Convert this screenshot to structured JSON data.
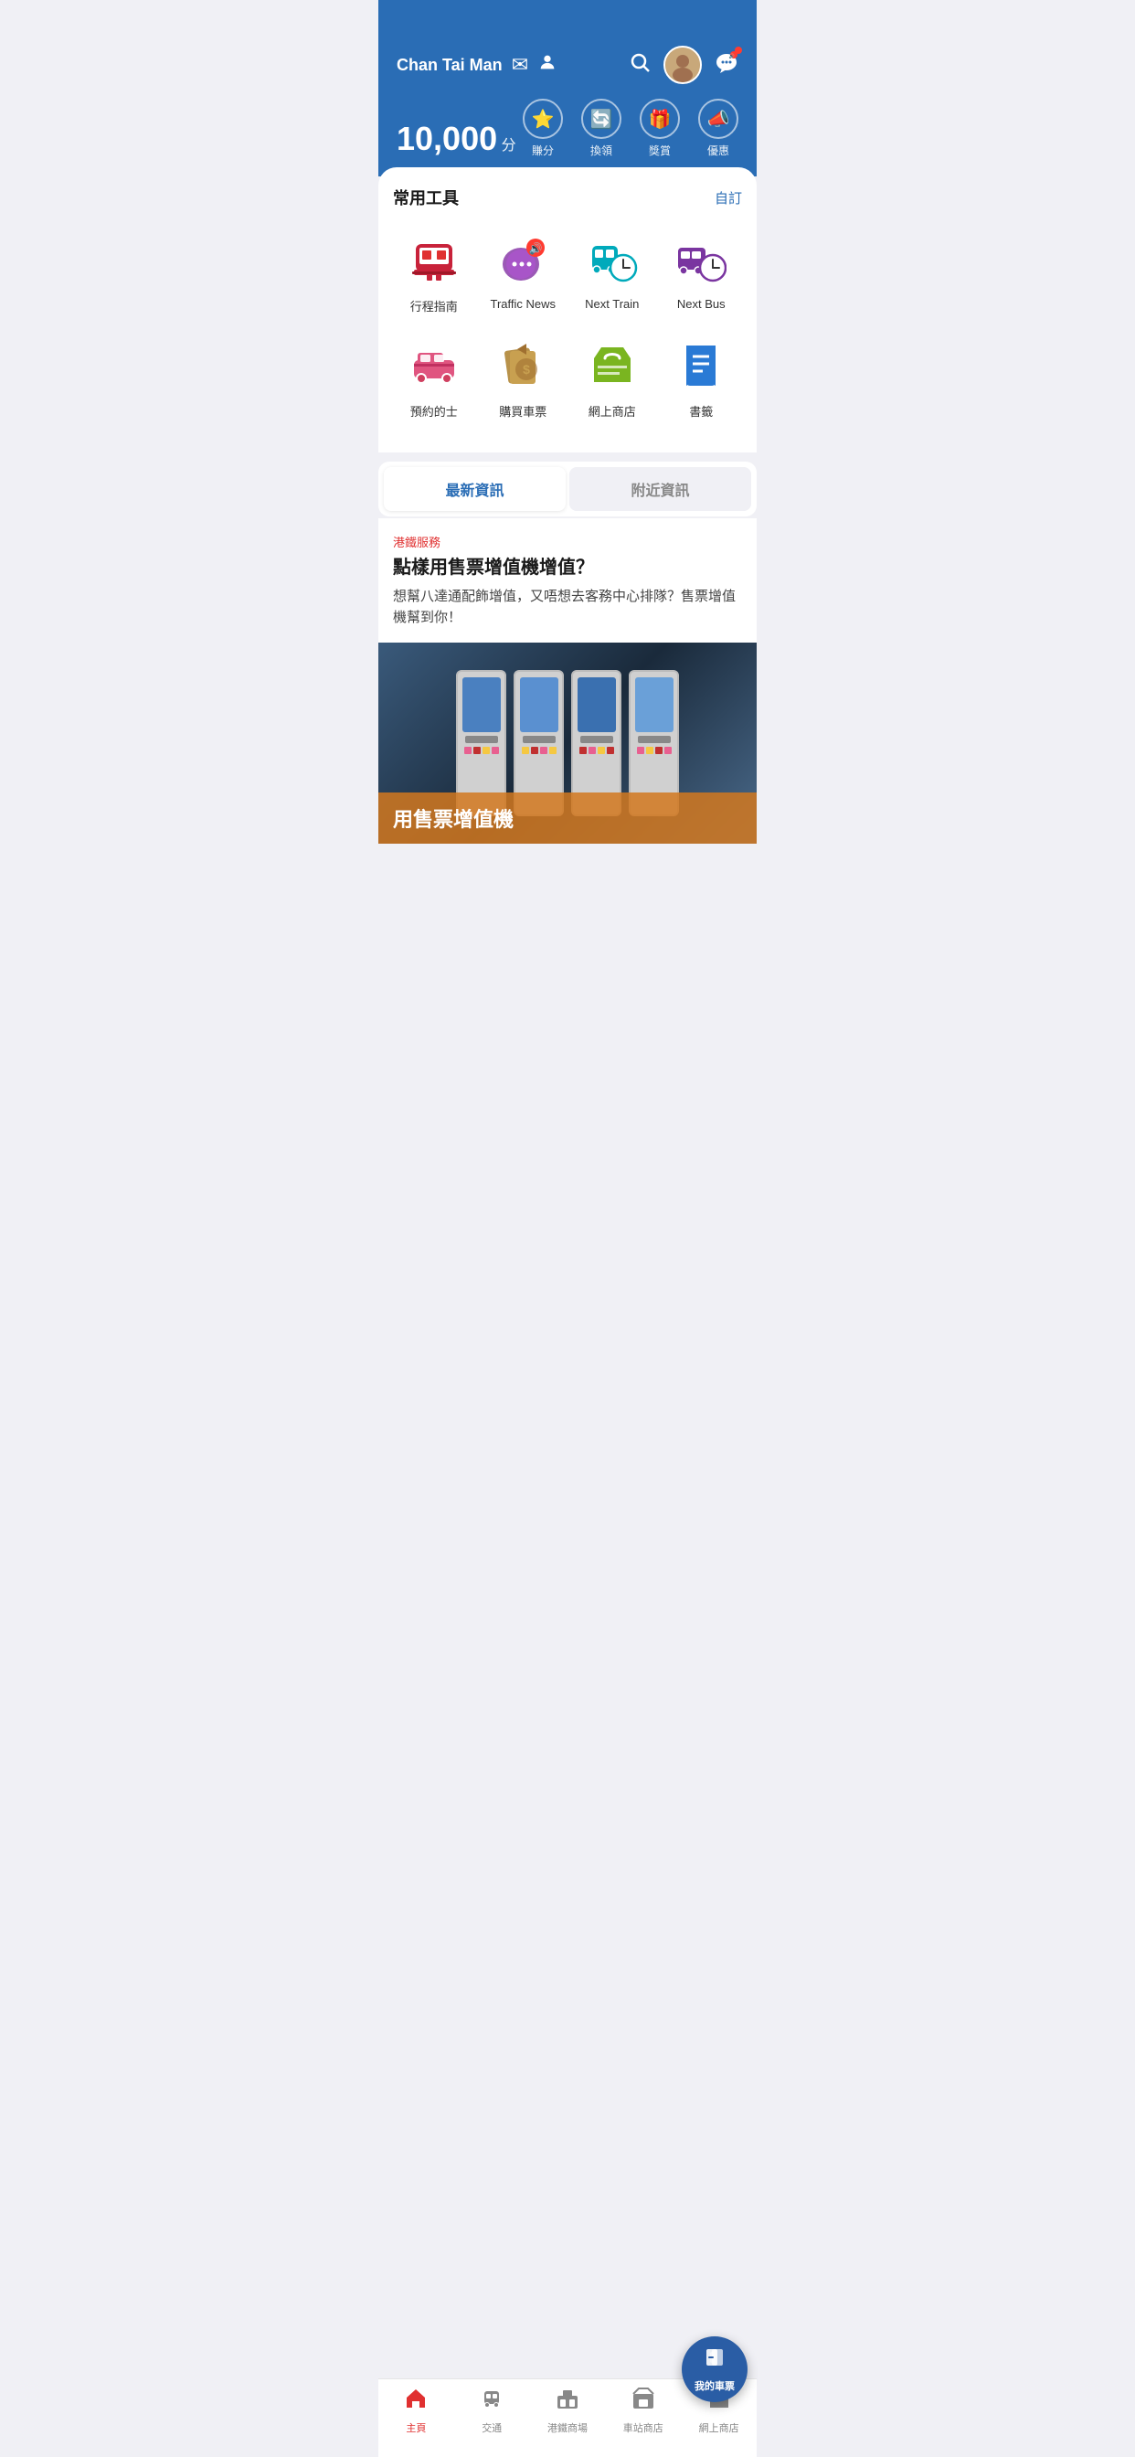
{
  "header": {
    "username": "Chan Tai Man",
    "points": "10,000",
    "points_unit": "分",
    "actions": [
      {
        "id": "earn",
        "label": "賺分",
        "icon": "⭐"
      },
      {
        "id": "redeem",
        "label": "換領",
        "icon": "🔄"
      },
      {
        "id": "rewards",
        "label": "獎賞",
        "icon": "🎁"
      },
      {
        "id": "offers",
        "label": "優惠",
        "icon": "📣"
      }
    ]
  },
  "tools": {
    "section_title": "常用工具",
    "customize_label": "自訂",
    "items": [
      {
        "id": "journey",
        "label": "行程指南"
      },
      {
        "id": "traffic",
        "label": "Traffic News"
      },
      {
        "id": "next_train",
        "label": "Next Train"
      },
      {
        "id": "next_bus",
        "label": "Next Bus"
      },
      {
        "id": "taxi",
        "label": "預約的士"
      },
      {
        "id": "buy_ticket",
        "label": "購買車票"
      },
      {
        "id": "shop",
        "label": "網上商店"
      },
      {
        "id": "bookmark",
        "label": "書籤"
      }
    ]
  },
  "news_tabs": {
    "tab1": "最新資訊",
    "tab2": "附近資訊"
  },
  "news": {
    "category": "港鐵服務",
    "title": "點樣用售票增值機增值？",
    "description": "想幫八達通配飾增值，又唔想去客務中心排隊？售票增值機幫到你！",
    "image_text": "用售票增值機"
  },
  "bottom_nav": {
    "items": [
      {
        "id": "home",
        "label": "主頁",
        "active": true
      },
      {
        "id": "transport",
        "label": "交通",
        "active": false
      },
      {
        "id": "mtr_mall",
        "label": "港鐵商場",
        "active": false
      },
      {
        "id": "station_shop",
        "label": "車站商店",
        "active": false
      },
      {
        "id": "online_shop",
        "label": "網上商店",
        "active": false
      }
    ],
    "fab_label": "我的車票"
  },
  "colors": {
    "header_bg": "#2a6db5",
    "accent_red": "#e03030",
    "accent_blue": "#2a5da5",
    "train_red": "#c8223a",
    "traffic_purple": "#9b59b6",
    "next_train_teal": "#00aabb",
    "next_bus_purple": "#7a35a0",
    "taxi_pink": "#e05580",
    "ticket_brown": "#a07040",
    "shop_green": "#7ab520",
    "bookmark_blue": "#2a7ad5"
  }
}
